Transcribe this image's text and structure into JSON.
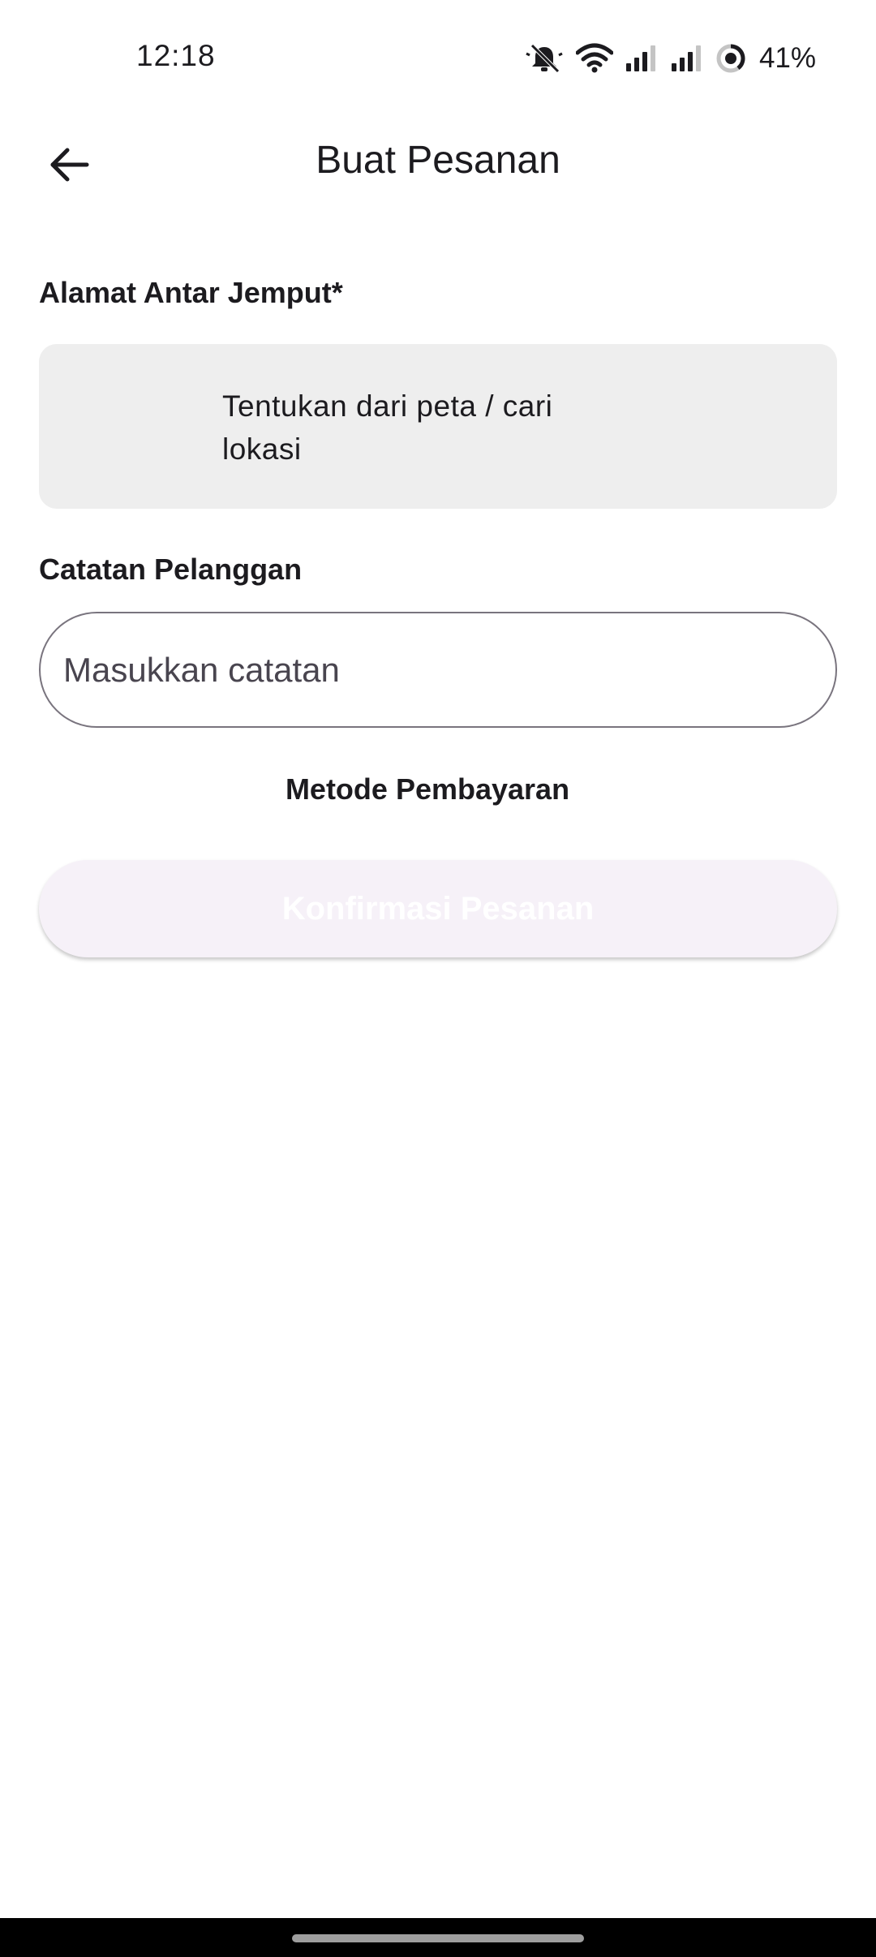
{
  "status_bar": {
    "time": "12:18",
    "battery": "41%",
    "icons": [
      "bell-off-icon",
      "wifi-icon",
      "signal-icon",
      "signal-icon",
      "battery-ring-icon"
    ]
  },
  "app_bar": {
    "title": "Buat Pesanan",
    "back_icon": "arrow-left-icon"
  },
  "form": {
    "address_label": "Alamat Antar Jemput*",
    "address_value": "Tentukan dari peta / cari lokasi",
    "notes_label": "Catatan Pelanggan",
    "notes_placeholder": "Masukkan catatan",
    "notes_value": "",
    "payment_label": "Metode Pembayaran",
    "confirm_label": "Konfirmasi Pesanan"
  },
  "colors": {
    "background": "#ffffff",
    "text": "#1c1b1f",
    "address_box": "#eeeeee",
    "input_border": "#79747e",
    "button_disabled": "#f6f1f8",
    "button_text": "#ffffff",
    "nav_bar": "#000000"
  }
}
